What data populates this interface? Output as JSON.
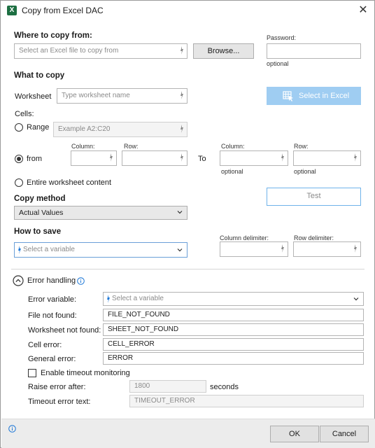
{
  "window": {
    "title": "Copy from Excel DAC",
    "app_icon": "X"
  },
  "where": {
    "heading": "Where to copy from:",
    "file_placeholder": "Select an Excel file to copy from",
    "browse_label": "Browse...",
    "password_label": "Password:",
    "password_optional": "optional"
  },
  "what": {
    "heading": "What to copy",
    "worksheet_label": "Worksheet",
    "worksheet_placeholder": "Type worksheet name",
    "select_in_excel_label": "Select in Excel",
    "cells_label": "Cells:",
    "range_label": "Range",
    "range_placeholder": "Example A2:C20",
    "from_label": "from",
    "column_label": "Column:",
    "row_label": "Row:",
    "to_label": "To",
    "to_column_label": "Column:",
    "to_row_label": "Row:",
    "optional_label": "optional",
    "optional_label_2": "optional",
    "entire_label": "Entire worksheet content",
    "selected_option": "from"
  },
  "copy_method": {
    "heading": "Copy method",
    "value": "Actual Values",
    "test_label": "Test"
  },
  "how_to_save": {
    "heading": "How to save",
    "variable_placeholder": "Select a variable",
    "column_delimiter_label": "Column delimiter:",
    "row_delimiter_label": "Row delimiter:"
  },
  "error_handling": {
    "heading": "Error handling",
    "error_variable_label": "Error variable:",
    "error_variable_placeholder": "Select a variable",
    "file_not_found_label": "File not found:",
    "file_not_found_value": "FILE_NOT_FOUND",
    "worksheet_not_found_label": "Worksheet not found:",
    "worksheet_not_found_value": "SHEET_NOT_FOUND",
    "cell_error_label": "Cell error:",
    "cell_error_value": "CELL_ERROR",
    "general_error_label": "General error:",
    "general_error_value": "ERROR",
    "timeout_monitoring_label": "Enable timeout monitoring",
    "timeout_monitoring_checked": false,
    "raise_after_label": "Raise error after:",
    "raise_after_value": "1800",
    "seconds_label": "seconds",
    "timeout_text_label": "Timeout error text:",
    "timeout_text_value": "TIMEOUT_ERROR"
  },
  "footer": {
    "ok_label": "OK",
    "cancel_label": "Cancel"
  },
  "colors": {
    "accent": "#1e78d7",
    "select_excel_bg": "#9fcdf2",
    "test_border": "#6fb3ea",
    "excel_green": "#1d6f42"
  }
}
